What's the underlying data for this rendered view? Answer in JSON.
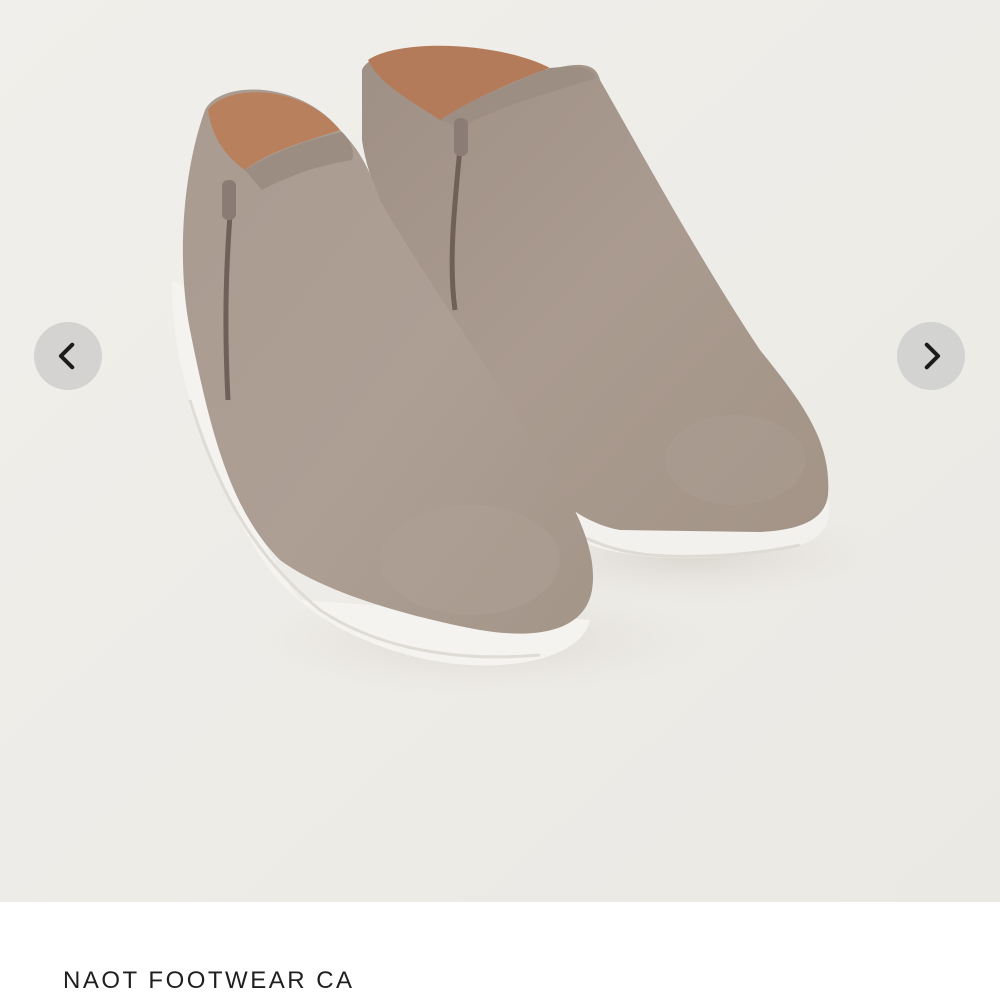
{
  "gallery": {
    "image_subject": "taupe suede ankle boots with side zippers and white soles",
    "background_color": "#efede8",
    "prev_icon": "chevron-left-icon",
    "next_icon": "chevron-right-icon"
  },
  "product": {
    "brand": "NAOT FOOTWEAR CA"
  },
  "colors": {
    "suede": "#a89a8f",
    "sole": "#f4f2ef",
    "lining": "#b9805e"
  }
}
